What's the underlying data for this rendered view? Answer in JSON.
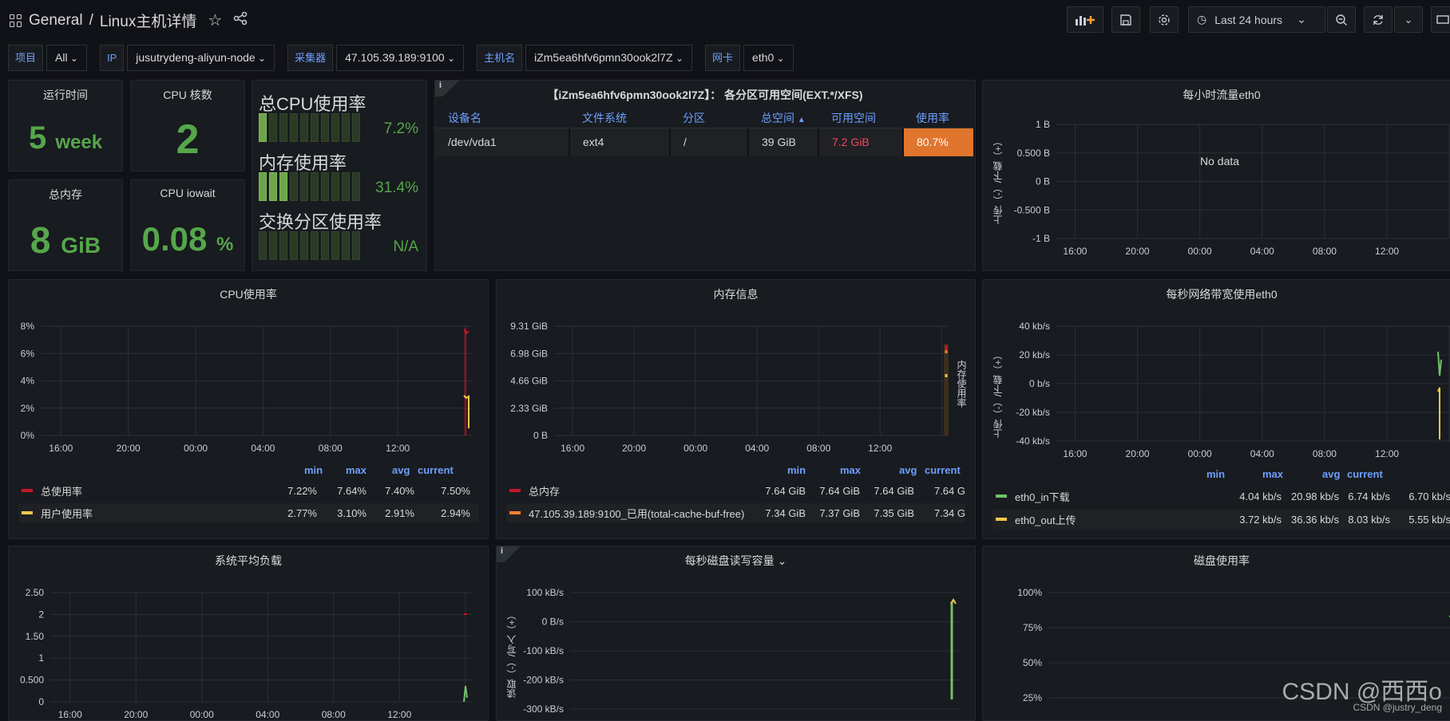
{
  "breadcrumb": {
    "folder": "General",
    "sep": "/",
    "title": "Linux主机详情"
  },
  "toolbar": {
    "time_range": "Last 24 hours"
  },
  "variables": [
    {
      "label": "项目",
      "value": "All"
    },
    {
      "label": "IP",
      "value": "jusutrydeng-aliyun-node"
    },
    {
      "label": "采集器",
      "value": "47.105.39.189:9100"
    },
    {
      "label": "主机名",
      "value": "iZm5ea6hfv6pmn30ook2l7Z"
    },
    {
      "label": "网卡",
      "value": "eth0"
    }
  ],
  "stats": {
    "uptime": {
      "title": "运行时间",
      "value": "5",
      "unit": "week"
    },
    "cpu_cores": {
      "title": "CPU 核数",
      "value": "2"
    },
    "total_mem": {
      "title": "总内存",
      "value": "8",
      "unit": "GiB"
    },
    "cpu_iowait": {
      "title": "CPU iowait",
      "value": "0.08",
      "unit": "%"
    }
  },
  "gauges": [
    {
      "label": "总CPU使用率",
      "value": "7.2%",
      "fraction": 0.072
    },
    {
      "label": "内存使用率",
      "value": "31.4%",
      "fraction": 0.314
    },
    {
      "label": "交换分区使用率",
      "value": "N/A",
      "fraction": 0
    }
  ],
  "disk_table": {
    "title": "【iZm5ea6hfv6pmn30ook2l7Z】： 各分区可用空间(EXT.*/XFS)",
    "headers": [
      "设备名",
      "文件系统",
      "分区",
      "总空间",
      "可用空间",
      "使用率"
    ],
    "row": [
      "/dev/vda1",
      "ext4",
      "/",
      "39 GiB",
      "7.2 GiB",
      "80.7%"
    ]
  },
  "hourly_traffic": {
    "title": "每小时流量eth0",
    "ylabel": "上传（-）/下载（+）",
    "yticks": [
      "1 B",
      "0.500 B",
      "0 B",
      "-0.500 B",
      "-1 B"
    ],
    "xticks": [
      "16:00",
      "20:00",
      "00:00",
      "04:00",
      "08:00",
      "12:00"
    ],
    "no_data": "No data"
  },
  "cpu_usage": {
    "title": "CPU使用率",
    "yticks": [
      "8%",
      "6%",
      "4%",
      "2%",
      "0%"
    ],
    "xticks": [
      "16:00",
      "20:00",
      "00:00",
      "04:00",
      "08:00",
      "12:00"
    ],
    "legend_cols": [
      "min",
      "max",
      "avg",
      "current"
    ],
    "series": [
      {
        "name": "总使用率",
        "color": "#c4162a",
        "vals": [
          "7.22%",
          "7.64%",
          "7.40%",
          "7.50%"
        ]
      },
      {
        "name": "用户使用率",
        "color": "#f2c94c",
        "vals": [
          "2.77%",
          "3.10%",
          "2.91%",
          "2.94%"
        ]
      }
    ]
  },
  "mem_info": {
    "title": "内存信息",
    "yticks": [
      "9.31 GiB",
      "6.98 GiB",
      "4.66 GiB",
      "2.33 GiB",
      "0 B"
    ],
    "xticks": [
      "16:00",
      "20:00",
      "00:00",
      "04:00",
      "08:00",
      "12:00"
    ],
    "right_label": "内存使用率",
    "legend_cols": [
      "min",
      "max",
      "avg",
      "current"
    ],
    "series": [
      {
        "name": "总内存",
        "color": "#c4162a",
        "vals": [
          "7.64 GiB",
          "7.64 GiB",
          "7.64 GiB",
          "7.64 G"
        ]
      },
      {
        "name": "47.105.39.189:9100_已用(total-cache-buf-free)",
        "color": "#ff7f2a",
        "vals": [
          "7.34 GiB",
          "7.37 GiB",
          "7.35 GiB",
          "7.34 G"
        ]
      }
    ]
  },
  "net_bw": {
    "title": "每秒网络带宽使用eth0",
    "ylabel": "上传（-）/下载（+）",
    "yticks": [
      "40 kb/s",
      "20 kb/s",
      "0 b/s",
      "-20 kb/s",
      "-40 kb/s"
    ],
    "xticks": [
      "16:00",
      "20:00",
      "00:00",
      "04:00",
      "08:00",
      "12:00"
    ],
    "legend_cols": [
      "min",
      "max",
      "avg",
      "current"
    ],
    "series": [
      {
        "name": "eth0_in下载",
        "color": "#73bf69",
        "vals": [
          "4.04 kb/s",
          "20.98 kb/s",
          "6.74 kb/s",
          "6.70 kb/s"
        ]
      },
      {
        "name": "eth0_out上传",
        "color": "#f2c94c",
        "vals": [
          "3.72 kb/s",
          "36.36 kb/s",
          "8.03 kb/s",
          "5.55 kb/s"
        ]
      }
    ]
  },
  "load_avg": {
    "title": "系统平均负载",
    "yticks": [
      "2.50",
      "2",
      "1.50",
      "1",
      "0.500",
      "0"
    ],
    "xticks": [
      "16:00",
      "20:00",
      "00:00",
      "04:00",
      "08:00",
      "12:00"
    ]
  },
  "disk_io": {
    "title": "每秒磁盘读写容量",
    "ylabel": "读取（-）/写入（+）",
    "yticks": [
      "100 kB/s",
      "0 B/s",
      "-100 kB/s",
      "-200 kB/s",
      "-300 kB/s"
    ]
  },
  "disk_usage": {
    "title": "磁盘使用率",
    "yticks": [
      "100%",
      "75%",
      "50%",
      "25%"
    ]
  },
  "watermark": {
    "big": "CSDN @西西o",
    "small": "CSDN @justry_deng"
  },
  "colors": {
    "green": "#56a64b",
    "orange": "#e0752d",
    "red": "#f2495c",
    "blue": "#6e9fff"
  }
}
